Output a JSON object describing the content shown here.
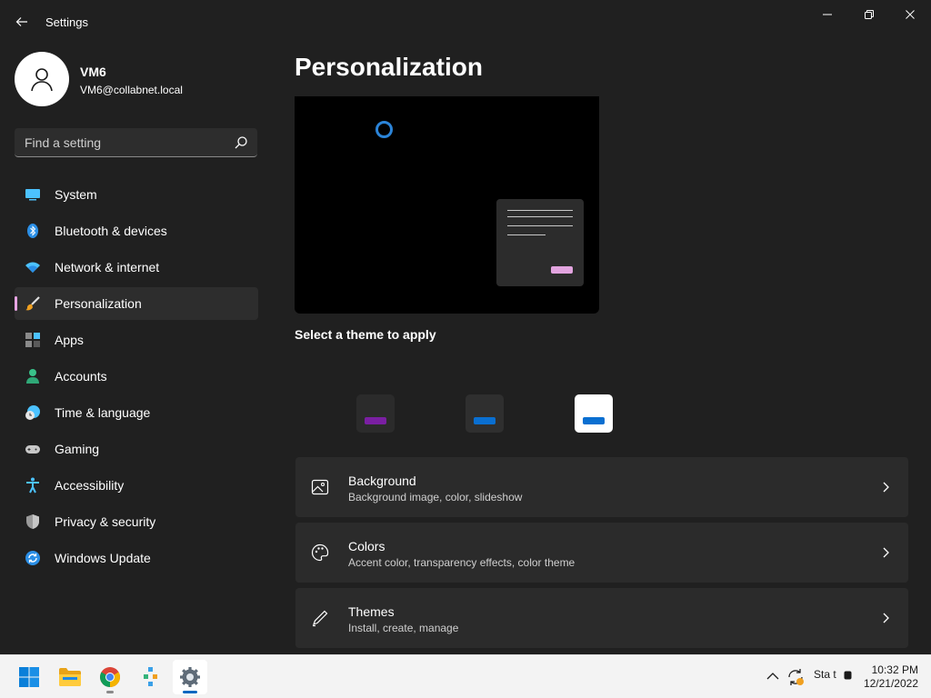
{
  "window": {
    "title": "Settings"
  },
  "profile": {
    "name": "VM6",
    "email": "VM6@collabnet.local"
  },
  "search": {
    "placeholder": "Find a setting",
    "value": ""
  },
  "sidebar": {
    "items": [
      {
        "label": "System",
        "icon": "system-icon",
        "active": false
      },
      {
        "label": "Bluetooth & devices",
        "icon": "bluetooth-icon",
        "active": false
      },
      {
        "label": "Network & internet",
        "icon": "wifi-icon",
        "active": false
      },
      {
        "label": "Personalization",
        "icon": "paintbrush-icon",
        "active": true
      },
      {
        "label": "Apps",
        "icon": "apps-icon",
        "active": false
      },
      {
        "label": "Accounts",
        "icon": "person-icon",
        "active": false
      },
      {
        "label": "Time & language",
        "icon": "clock-globe-icon",
        "active": false
      },
      {
        "label": "Gaming",
        "icon": "gamepad-icon",
        "active": false
      },
      {
        "label": "Accessibility",
        "icon": "accessibility-icon",
        "active": false
      },
      {
        "label": "Privacy & security",
        "icon": "shield-icon",
        "active": false
      },
      {
        "label": "Windows Update",
        "icon": "update-icon",
        "active": false
      }
    ]
  },
  "main": {
    "title": "Personalization",
    "theme_section_label": "Select a theme to apply",
    "themes": [
      {
        "name": "dark-purple",
        "bg": "#2b2b2b",
        "accent": "#7a1fa2"
      },
      {
        "name": "dark-blue",
        "bg": "#2f2f2f",
        "accent": "#0a6fd1"
      },
      {
        "name": "light-blue",
        "bg": "#ffffff",
        "accent": "#0a6fd1"
      }
    ],
    "cards": [
      {
        "title": "Background",
        "subtitle": "Background image, color, slideshow",
        "icon": "image-icon"
      },
      {
        "title": "Colors",
        "subtitle": "Accent color, transparency effects, color theme",
        "icon": "palette-icon"
      },
      {
        "title": "Themes",
        "subtitle": "Install, create, manage",
        "icon": "pen-icon"
      }
    ]
  },
  "taskbar": {
    "apps": [
      {
        "name": "start-button",
        "icon": "windows-logo-icon"
      },
      {
        "name": "file-explorer",
        "icon": "folder-icon"
      },
      {
        "name": "chrome",
        "icon": "chrome-icon"
      },
      {
        "name": "network-app",
        "icon": "network-app-icon"
      },
      {
        "name": "settings",
        "icon": "gear-icon"
      }
    ],
    "tray_text": "Sta  t",
    "time": "10:32 PM",
    "date": "12/21/2022"
  },
  "colors": {
    "accent_pink": "#e7a4e3",
    "windows_blue": "#0067c0"
  }
}
